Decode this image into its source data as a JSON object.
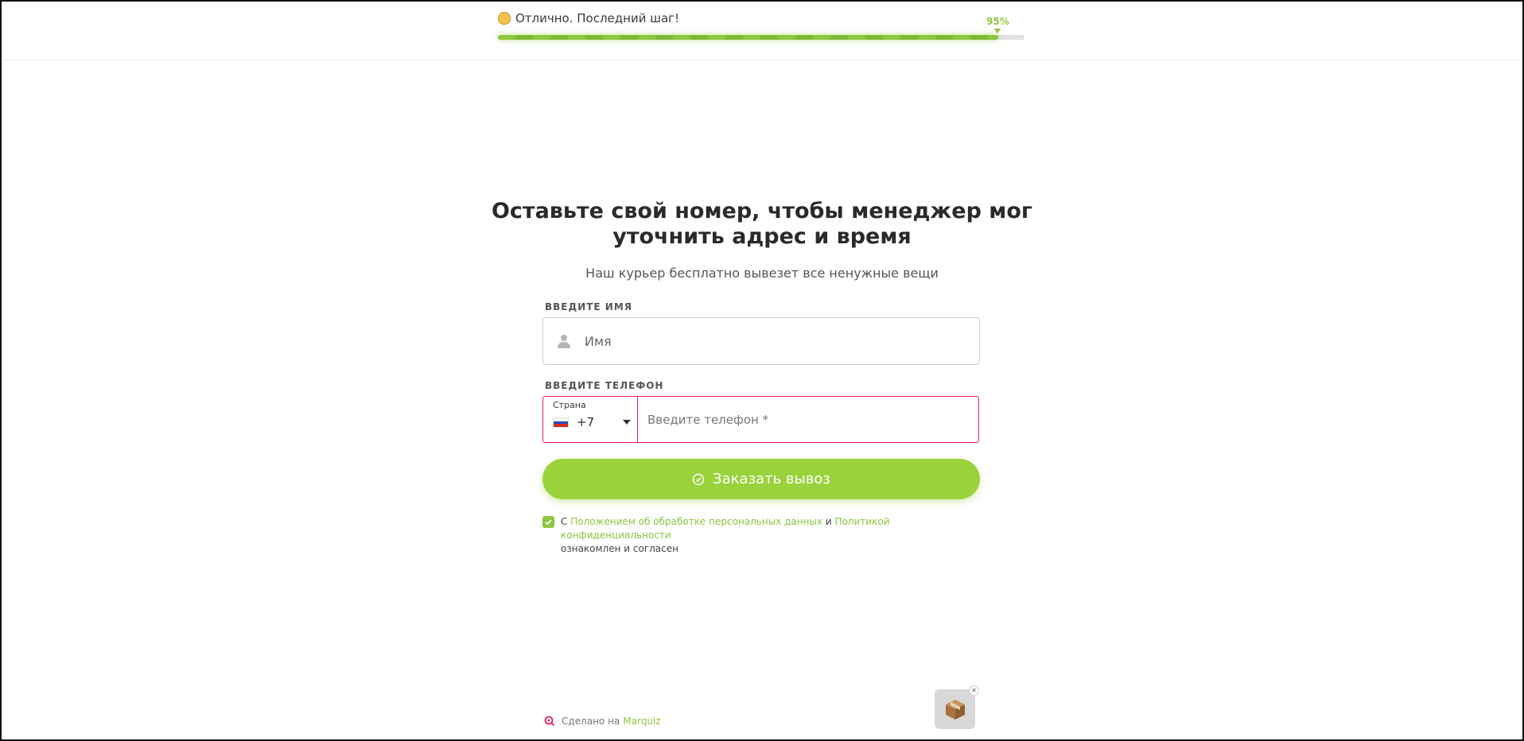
{
  "progress": {
    "message": "Отлично. Последний шаг!",
    "percent_label": "95%",
    "percent": 95
  },
  "form": {
    "title": "Оставьте свой номер, чтобы менеджер мог уточнить адрес и время",
    "subtitle": "Наш курьер бесплатно вывезет все ненужные вещи",
    "name_label": "ВВЕДИТЕ ИМЯ",
    "name_placeholder": "Имя",
    "phone_label": "ВВЕДИТЕ ТЕЛЕФОН",
    "country_label": "Страна",
    "country_code": "+7",
    "phone_placeholder": "Введите телефон *",
    "submit_label": "Заказать вывоз"
  },
  "consent": {
    "prefix": "С",
    "link1": "Положением об обработке персональных данных",
    "and": "и",
    "link2": "Политикой конфиденциальности",
    "suffix": "ознакомлен и согласен",
    "checked": true
  },
  "footer": {
    "made_with": "Сделано на",
    "brand": "Marquiz"
  },
  "colors": {
    "accent": "#9ad23c",
    "error": "#e0245e",
    "brand_pink": "#e0245e"
  }
}
